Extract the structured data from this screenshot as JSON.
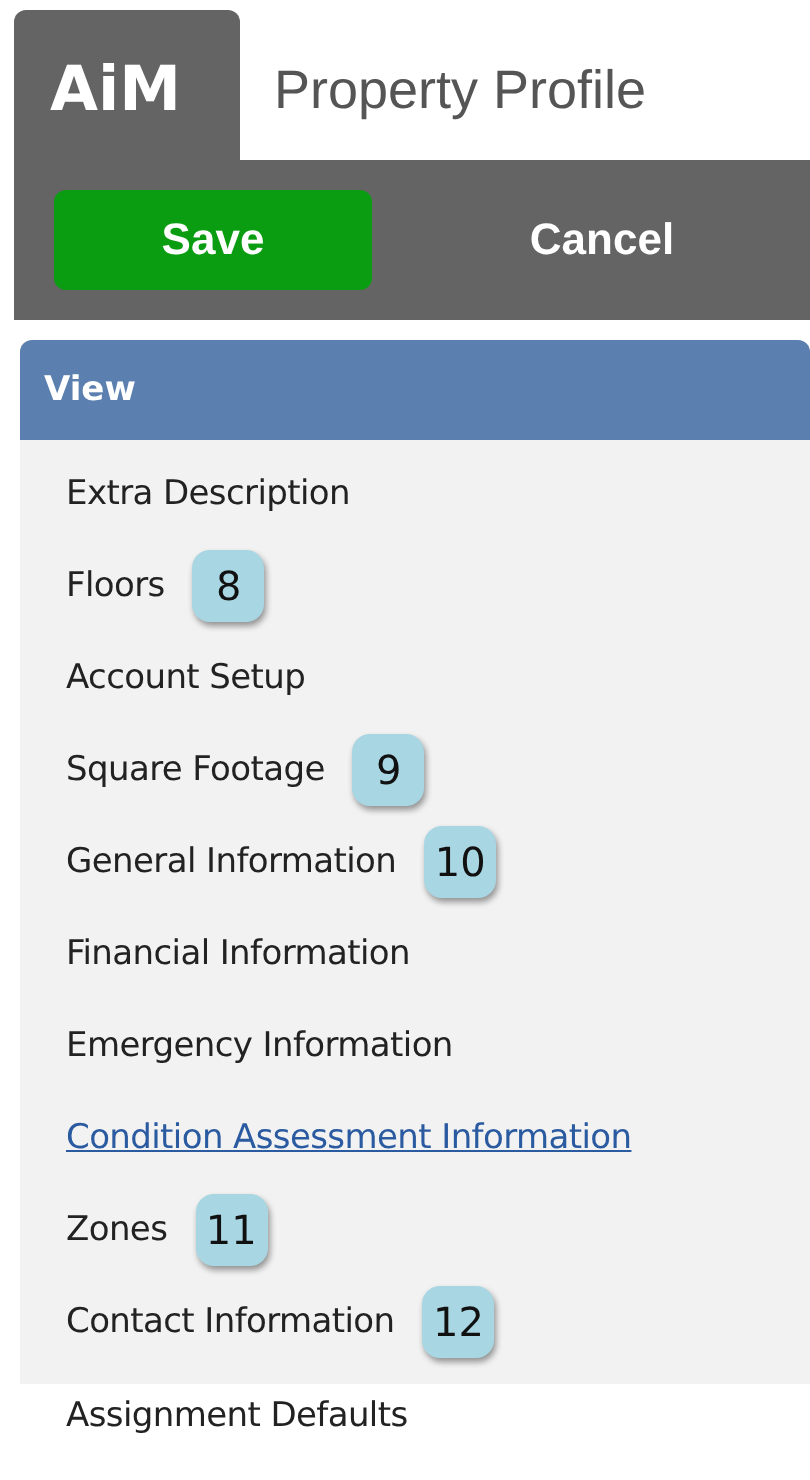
{
  "header": {
    "logo": "AiM",
    "title": "Property Profile"
  },
  "toolbar": {
    "buttons": [
      {
        "label": "Save",
        "kind": "primary"
      },
      {
        "label": "Cancel",
        "kind": "plain"
      }
    ]
  },
  "panel": {
    "title": "View",
    "items": [
      {
        "label": "Extra Description",
        "kind": "text"
      },
      {
        "label": "Floors",
        "kind": "text",
        "badge": "8"
      },
      {
        "label": "Account Setup",
        "kind": "text"
      },
      {
        "label": "Square Footage",
        "kind": "text",
        "badge": "9"
      },
      {
        "label": "General Information",
        "kind": "text",
        "badge": "10"
      },
      {
        "label": "Financial Information",
        "kind": "text"
      },
      {
        "label": "Emergency Information",
        "kind": "text"
      },
      {
        "label": "Condition Assessment Information",
        "kind": "link"
      },
      {
        "label": "Zones",
        "kind": "text",
        "badge": "11"
      },
      {
        "label": "Contact Information",
        "kind": "text",
        "badge": "12"
      }
    ]
  },
  "after": [
    {
      "label": "Assignment Defaults"
    }
  ]
}
